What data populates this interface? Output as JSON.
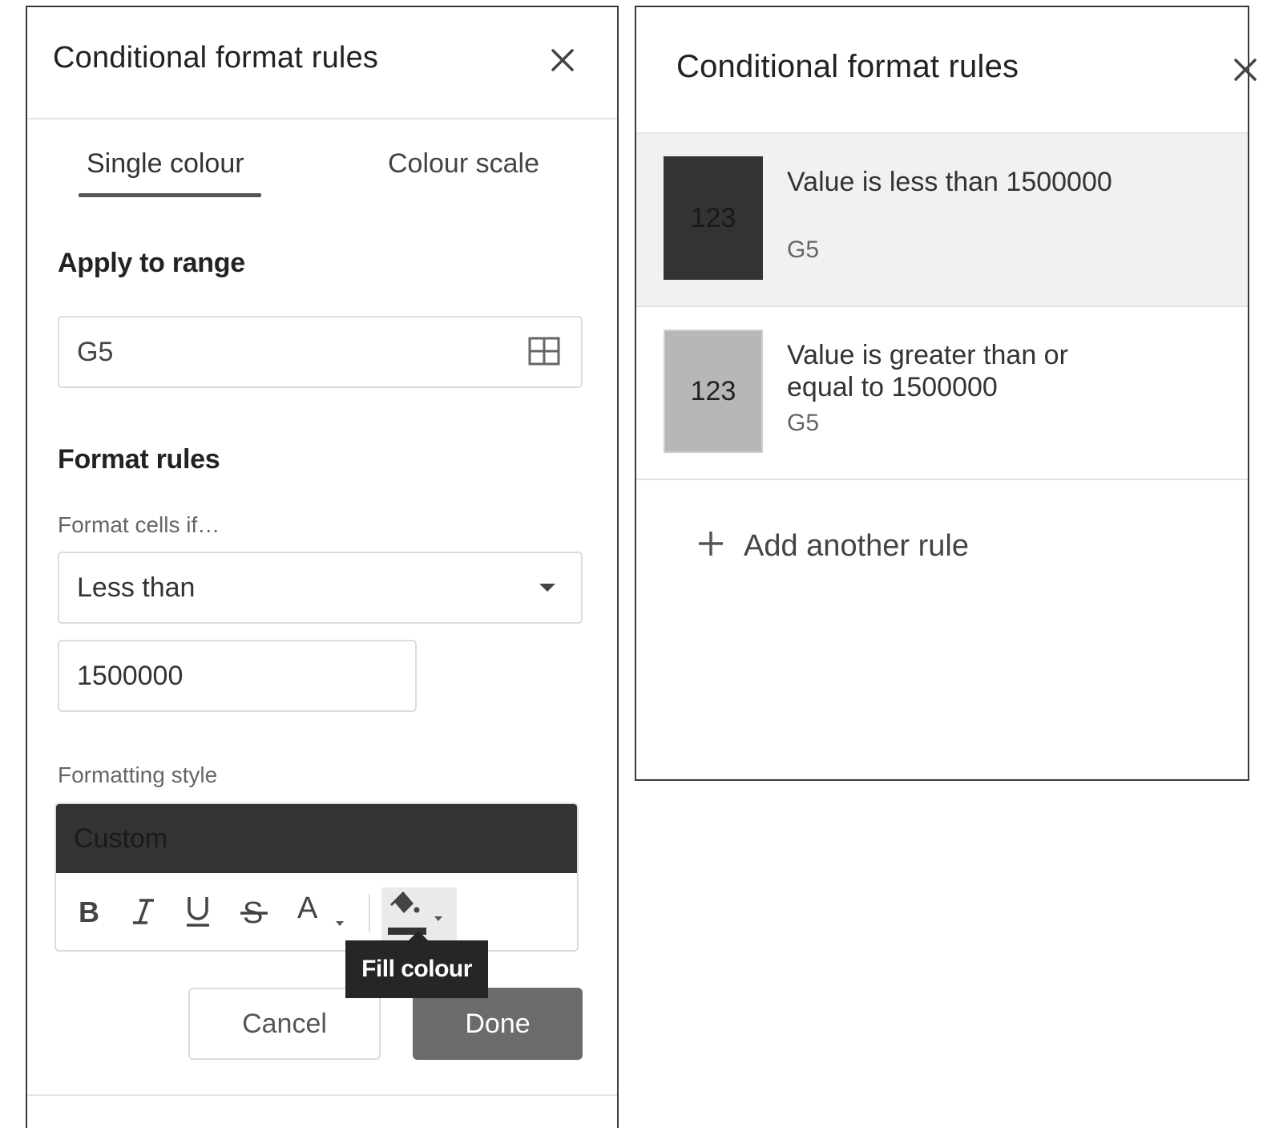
{
  "editor": {
    "title": "Conditional format rules",
    "tabs": [
      {
        "label": "Single colour",
        "active": true
      },
      {
        "label": "Colour scale",
        "active": false
      }
    ],
    "apply_to_range": {
      "heading": "Apply to range",
      "value": "G5"
    },
    "format_rules": {
      "heading": "Format rules",
      "condition_label": "Format cells if…",
      "condition_value": "Less than",
      "value_input": "1500000"
    },
    "formatting_style": {
      "label": "Formatting style",
      "preview_text": "Custom",
      "fill_color": "#333333",
      "tools": [
        "bold-icon",
        "italic-icon",
        "underline-icon",
        "strikethrough-icon",
        "text-color-icon",
        "fill-color-icon"
      ]
    },
    "tooltip": "Fill colour",
    "buttons": {
      "cancel": "Cancel",
      "done": "Done"
    }
  },
  "rules_list": {
    "title": "Conditional format rules",
    "rules": [
      {
        "swatch_text": "123",
        "description": "Value is less than 1500000",
        "range": "G5",
        "fill_color": "#333333"
      },
      {
        "swatch_text": "123",
        "description": "Value is greater than or equal to 1500000",
        "range": "G5",
        "fill_color": "#b7b7b7"
      }
    ],
    "add_rule": "Add another rule"
  }
}
